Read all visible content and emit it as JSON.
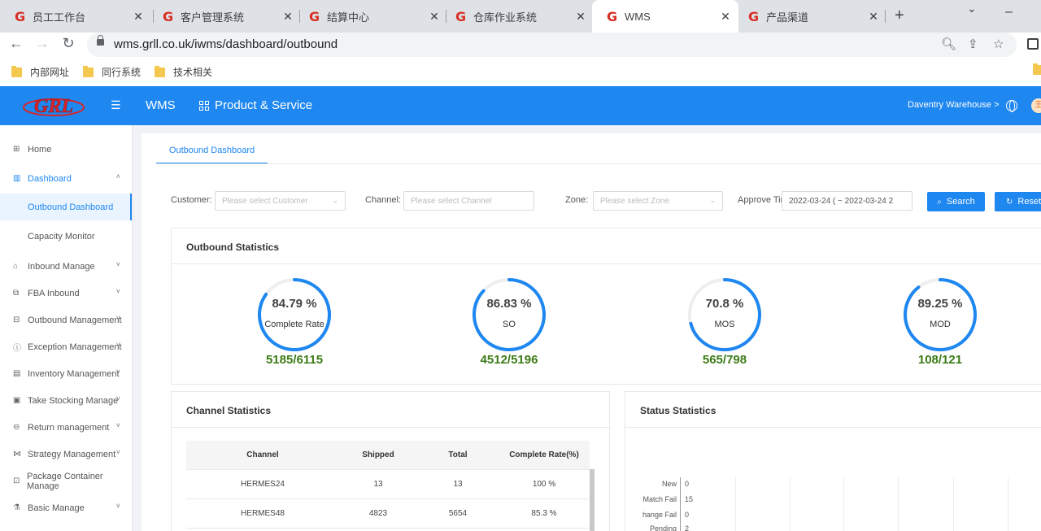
{
  "browser": {
    "tabs": [
      {
        "title": "员工工作台",
        "active": false
      },
      {
        "title": "客户管理系统",
        "active": false
      },
      {
        "title": "结算中心",
        "active": false
      },
      {
        "title": "仓库作业系统",
        "active": false
      },
      {
        "title": "WMS",
        "active": true
      },
      {
        "title": "产品渠道",
        "active": false
      }
    ],
    "url": "wms.grll.co.uk/iwms/dashboard/outbound",
    "bookmarks": [
      "内部网址",
      "同行系统",
      "技术相关"
    ]
  },
  "header": {
    "logo_text": "GRL",
    "app_title": "WMS",
    "product_link": "Product & Service",
    "warehouse": "Daventry Warehouse >",
    "avatar_text": "王",
    "brand_color": "#1e87f0"
  },
  "sidebar": {
    "items": [
      {
        "label": "Home",
        "icon": "grid-icon"
      },
      {
        "label": "Dashboard",
        "icon": "bar-chart-icon",
        "expanded": true
      },
      {
        "label": "Outbound Dashboard",
        "sub": true,
        "active": true
      },
      {
        "label": "Capacity Monitor",
        "sub": true
      },
      {
        "label": "Inbound Manage",
        "icon": "bank-icon"
      },
      {
        "label": "FBA Inbound",
        "icon": "fba-icon"
      },
      {
        "label": "Outbound Management",
        "icon": "outbound-icon"
      },
      {
        "label": "Exception Management",
        "icon": "exception-icon"
      },
      {
        "label": "Inventory Management",
        "icon": "inventory-icon"
      },
      {
        "label": "Take Stocking Manage",
        "icon": "stocking-icon"
      },
      {
        "label": "Return management",
        "icon": "return-icon"
      },
      {
        "label": "Strategy Management",
        "icon": "strategy-icon"
      },
      {
        "label": "Package Container Manage",
        "icon": "package-icon"
      },
      {
        "label": "Basic Manage",
        "icon": "basic-icon"
      }
    ]
  },
  "page": {
    "tab": "Outbound Dashboard",
    "filters": {
      "customer_label": "Customer:",
      "customer_placeholder": "Please select Customer",
      "channel_label": "Channel:",
      "channel_placeholder": "Please select Channel",
      "zone_label": "Zone:",
      "zone_placeholder": "Please select Zone",
      "approve_label": "Approve Tir",
      "approve_value": "2022-03-24 ( ~ 2022-03-24 2",
      "search_label": "Search",
      "reset_label": "Reset"
    },
    "outbound_statistics": {
      "title": "Outbound Statistics",
      "gauges": [
        {
          "pct_label": "84.79 %",
          "name": "Complete Rate",
          "count": "5185/6115",
          "fraction": 0.8479
        },
        {
          "pct_label": "86.83 %",
          "name": "SO",
          "count": "4512/5196",
          "fraction": 0.8683
        },
        {
          "pct_label": "70.8 %",
          "name": "MOS",
          "count": "565/798",
          "fraction": 0.708
        },
        {
          "pct_label": "89.25 %",
          "name": "MOD",
          "count": "108/121",
          "fraction": 0.8925
        }
      ]
    },
    "channel_statistics": {
      "title": "Channel Statistics",
      "columns": [
        "Channel",
        "Shipped",
        "Total",
        "Complete Rate(%)"
      ],
      "rows": [
        [
          "HERMES24",
          "13",
          "13",
          "100 %"
        ],
        [
          "HERMES48",
          "4823",
          "5654",
          "85.3 %"
        ]
      ]
    },
    "status_statistics": {
      "title": "Status Statistics",
      "categories": [
        "New",
        "Match Fail",
        "hange Fail",
        "Pending"
      ],
      "values": [
        "0",
        "15",
        "0",
        "2"
      ]
    }
  }
}
